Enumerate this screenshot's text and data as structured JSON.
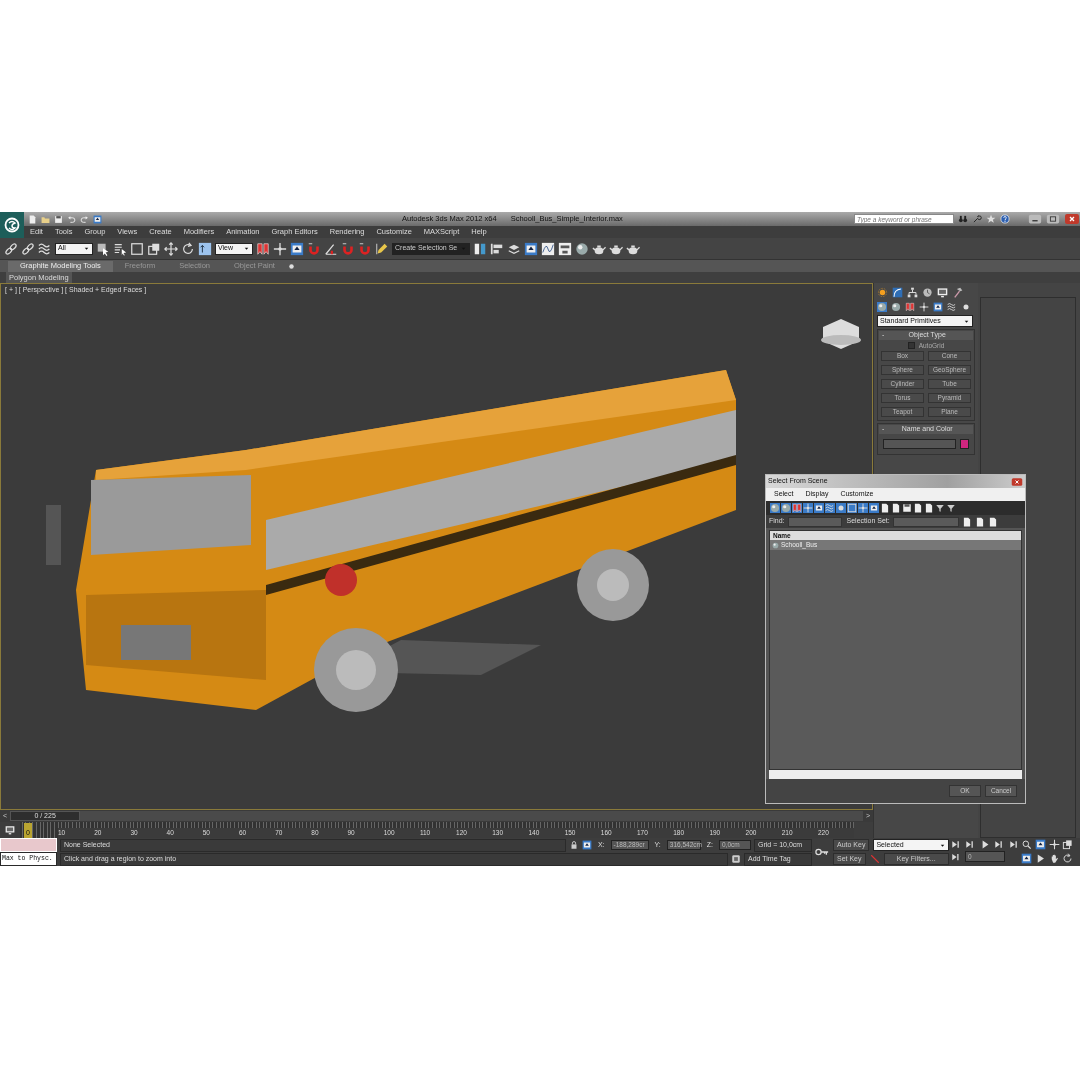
{
  "window": {
    "title": "Autodesk 3ds Max  2012 x64",
    "file": "Schooll_Bus_Simple_Interior.max"
  },
  "search": {
    "placeholder": "Type a keyword or phrase"
  },
  "menu": [
    "Edit",
    "Tools",
    "Group",
    "Views",
    "Create",
    "Modifiers",
    "Animation",
    "Graph Editors",
    "Rendering",
    "Customize",
    "MAXScript",
    "Help"
  ],
  "toolbar": {
    "selection_filter": "All",
    "reference_coordinate_system": "View",
    "named_selection_set": "Create Selection Se"
  },
  "ribbon": {
    "tabs": [
      {
        "label": "Graphite Modeling Tools",
        "selected": true
      },
      {
        "label": "Freeform",
        "selected": false
      },
      {
        "label": "Selection",
        "selected": false
      },
      {
        "label": "Object Paint",
        "selected": false
      }
    ],
    "panel": "Polygon Modeling"
  },
  "viewport": {
    "label": "[ + ] [ Perspective ] [ Shaded + Edged Faces ]"
  },
  "command_panel": {
    "category": "Standard Primitives",
    "rollouts": [
      {
        "sign": "-",
        "title": "Object Type",
        "autogrid": {
          "label": "AutoGrid",
          "checked": false
        },
        "buttons": [
          "Box",
          "Cone",
          "Sphere",
          "GeoSphere",
          "Cylinder",
          "Tube",
          "Torus",
          "Pyramid",
          "Teapot",
          "Plane"
        ]
      },
      {
        "sign": "-",
        "title": "Name and Color"
      }
    ]
  },
  "dialog": {
    "title": "Select From Scene",
    "menu": [
      "Select",
      "Display",
      "Customize"
    ],
    "find_label": "Find:",
    "selection_set_label": "Selection Set:",
    "column": "Name",
    "items": [
      {
        "name": "Schooll_Bus",
        "selected": true
      }
    ],
    "buttons": [
      "OK",
      "Cancel"
    ]
  },
  "timeline": {
    "prev": "<",
    "position": "0 / 225",
    "level": 0,
    "next": ">",
    "current": "0",
    "ticks": [
      "10",
      "20",
      "30",
      "40",
      "50",
      "60",
      "70",
      "80",
      "90",
      "100",
      "110",
      "120",
      "130",
      "140",
      "150",
      "160",
      "170",
      "180",
      "190",
      "200",
      "210",
      "220"
    ]
  },
  "status_bar": {
    "listener": "Max to Physc.",
    "selection": "None Selected",
    "prompt": "Click and drag a region to zoom into",
    "x_label": "X:",
    "x": "-188,289cr",
    "y_label": "Y:",
    "y": "316,542cm",
    "z_label": "Z:",
    "z": "0,0cm",
    "grid": "Grid = 10,0cm",
    "time_tag": "Add Time Tag",
    "auto_key": "Auto Key",
    "set_key": "Set Key",
    "key_mode": "Selected",
    "key_filters": "Key Filters...",
    "current_frame": "0"
  }
}
